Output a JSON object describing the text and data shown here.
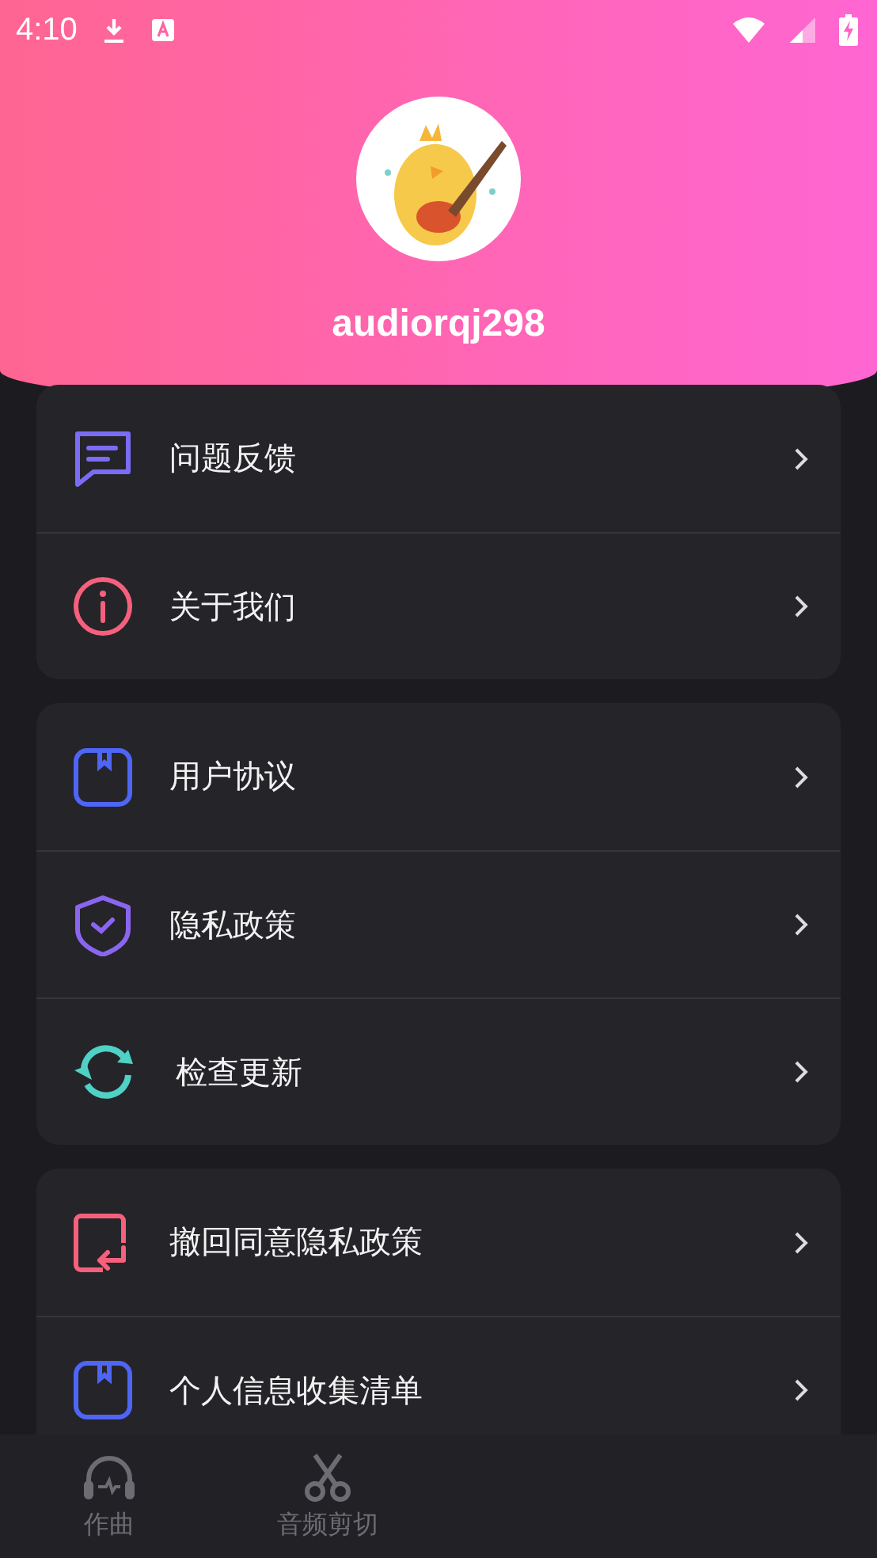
{
  "status_bar": {
    "time": "4:10"
  },
  "profile": {
    "username": "audiorqj298"
  },
  "menu_groups": [
    {
      "items": [
        {
          "label": "问题反馈",
          "kind": "feedback"
        },
        {
          "label": "关于我们",
          "kind": "info"
        }
      ]
    },
    {
      "items": [
        {
          "label": "用户协议",
          "kind": "document"
        },
        {
          "label": "隐私政策",
          "kind": "shield"
        },
        {
          "label": "检查更新",
          "kind": "refresh"
        }
      ]
    },
    {
      "items": [
        {
          "label": "撤回同意隐私政策",
          "kind": "revoke"
        },
        {
          "label": "个人信息收集清单",
          "kind": "document"
        }
      ]
    }
  ],
  "bottom_nav": [
    {
      "label": "作曲",
      "kind": "headphones",
      "selected": false
    },
    {
      "label": "音频剪切",
      "kind": "scissors",
      "selected": false
    }
  ]
}
